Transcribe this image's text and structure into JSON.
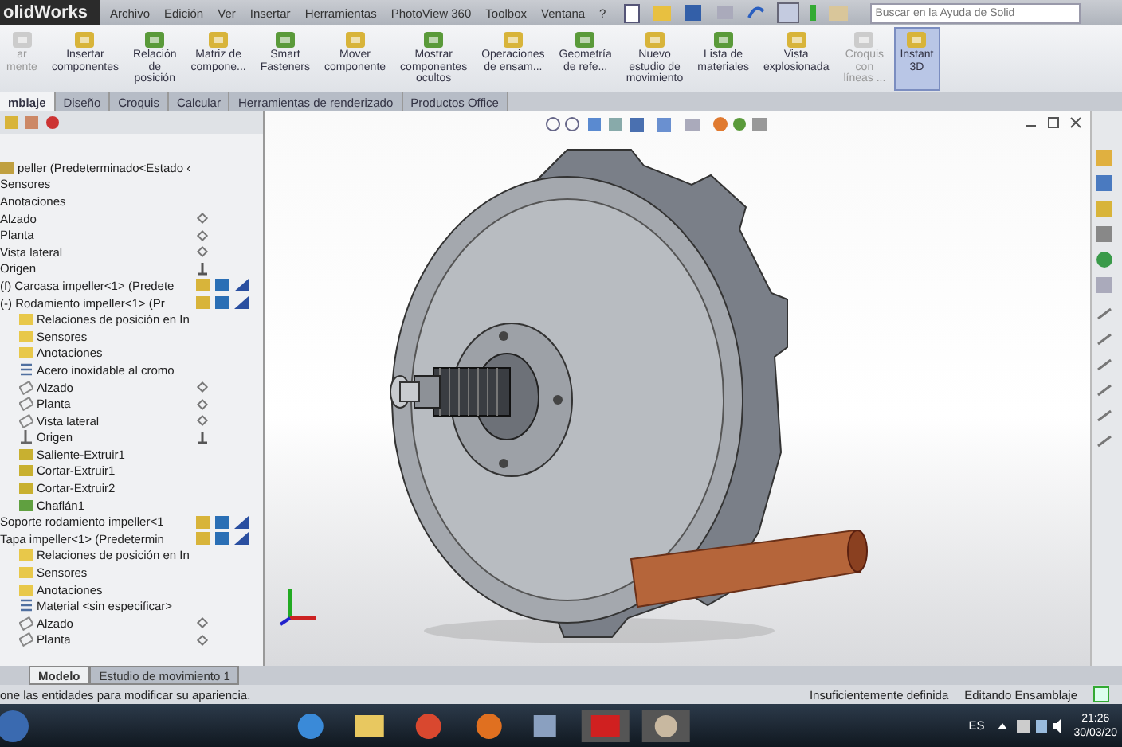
{
  "app": {
    "logo": "olidWorks",
    "menu": [
      "Archivo",
      "Edición",
      "Ver",
      "Insertar",
      "Herramientas",
      "PhotoView 360",
      "Toolbox",
      "Ventana",
      "?"
    ],
    "search": {
      "placeholder": "Buscar en la Ayuda de Solid"
    }
  },
  "ribbon": [
    {
      "label": "ar\nmente",
      "disabled": true,
      "selected": false
    },
    {
      "label": "Insertar\ncomponentes",
      "disabled": false,
      "selected": false
    },
    {
      "label": "Relación\nde\nposición",
      "disabled": false,
      "selected": false
    },
    {
      "label": "Matriz de\ncompone...",
      "disabled": false,
      "selected": false
    },
    {
      "label": "Smart\nFasteners",
      "disabled": false,
      "selected": false
    },
    {
      "label": "Mover\ncomponente",
      "disabled": false,
      "selected": false
    },
    {
      "label": "Mostrar\ncomponentes\nocultos",
      "disabled": false,
      "selected": false
    },
    {
      "label": "Operaciones\nde ensam...",
      "disabled": false,
      "selected": false
    },
    {
      "label": "Geometría\nde refe...",
      "disabled": false,
      "selected": false
    },
    {
      "label": "Nuevo\nestudio de\nmovimiento",
      "disabled": false,
      "selected": false
    },
    {
      "label": "Lista de\nmateriales",
      "disabled": false,
      "selected": false
    },
    {
      "label": "Vista\nexplosionada",
      "disabled": false,
      "selected": false
    },
    {
      "label": "Croquis\ncon\nlíneas ...",
      "disabled": true,
      "selected": false
    },
    {
      "label": "Instant\n3D",
      "disabled": false,
      "selected": true
    }
  ],
  "tabs": [
    {
      "label": "mblaje",
      "selected": true
    },
    {
      "label": "Diseño",
      "selected": false
    },
    {
      "label": "Croquis",
      "selected": false
    },
    {
      "label": "Calcular",
      "selected": false
    },
    {
      "label": "Herramientas de renderizado",
      "selected": false
    },
    {
      "label": "Productos Office",
      "selected": false
    }
  ],
  "tree": [
    {
      "label": "peller (Predeterminado<Estado ‹",
      "kind": "assembly",
      "children": [
        {
          "label": "Sensores"
        },
        {
          "label": "Anotaciones"
        },
        {
          "label": "Alzado"
        },
        {
          "label": "Planta"
        },
        {
          "label": "Vista lateral"
        },
        {
          "label": "Origen"
        },
        {
          "label": "(f) Carcasa impeller<1> (Predete"
        },
        {
          "label": "(-) Rodamiento impeller<1> (Pr",
          "children": [
            {
              "label": "Relaciones de posición en In",
              "kind": "folder"
            },
            {
              "label": "Sensores",
              "kind": "folder"
            },
            {
              "label": "Anotaciones",
              "kind": "annotation"
            },
            {
              "label": "Acero inoxidable al cromo",
              "kind": "material"
            },
            {
              "label": "Alzado",
              "kind": "plane"
            },
            {
              "label": "Planta",
              "kind": "plane"
            },
            {
              "label": "Vista lateral",
              "kind": "plane"
            },
            {
              "label": "Origen",
              "kind": "origin"
            },
            {
              "label": "Saliente-Extruir1",
              "kind": "feature"
            },
            {
              "label": "Cortar-Extruir1",
              "kind": "feature"
            },
            {
              "label": "Cortar-Extruir2",
              "kind": "feature"
            },
            {
              "label": "Chaflán1",
              "kind": "chamfer"
            }
          ]
        },
        {
          "label": "Soporte rodamiento impeller<1"
        },
        {
          "label": "Tapa impeller<1> (Predetermin",
          "children": [
            {
              "label": "Relaciones de posición en In",
              "kind": "folder"
            },
            {
              "label": "Sensores",
              "kind": "folder"
            },
            {
              "label": "Anotaciones",
              "kind": "annotation"
            },
            {
              "label": "Material <sin especificar>",
              "kind": "material"
            },
            {
              "label": "Alzado",
              "kind": "plane"
            },
            {
              "label": "Planta",
              "kind": "plane"
            }
          ]
        }
      ]
    }
  ],
  "bottom_tabs": [
    {
      "label": "Modelo",
      "selected": true
    },
    {
      "label": "Estudio de movimiento 1",
      "selected": false
    }
  ],
  "status_bar": {
    "message": "one las entidades para modificar su apariencia.",
    "definition": "Insuficientemente definida",
    "mode": "Editando Ensamblaje"
  },
  "taskbar": {
    "language": "ES",
    "time": "21:26",
    "date": "30/03/20"
  }
}
